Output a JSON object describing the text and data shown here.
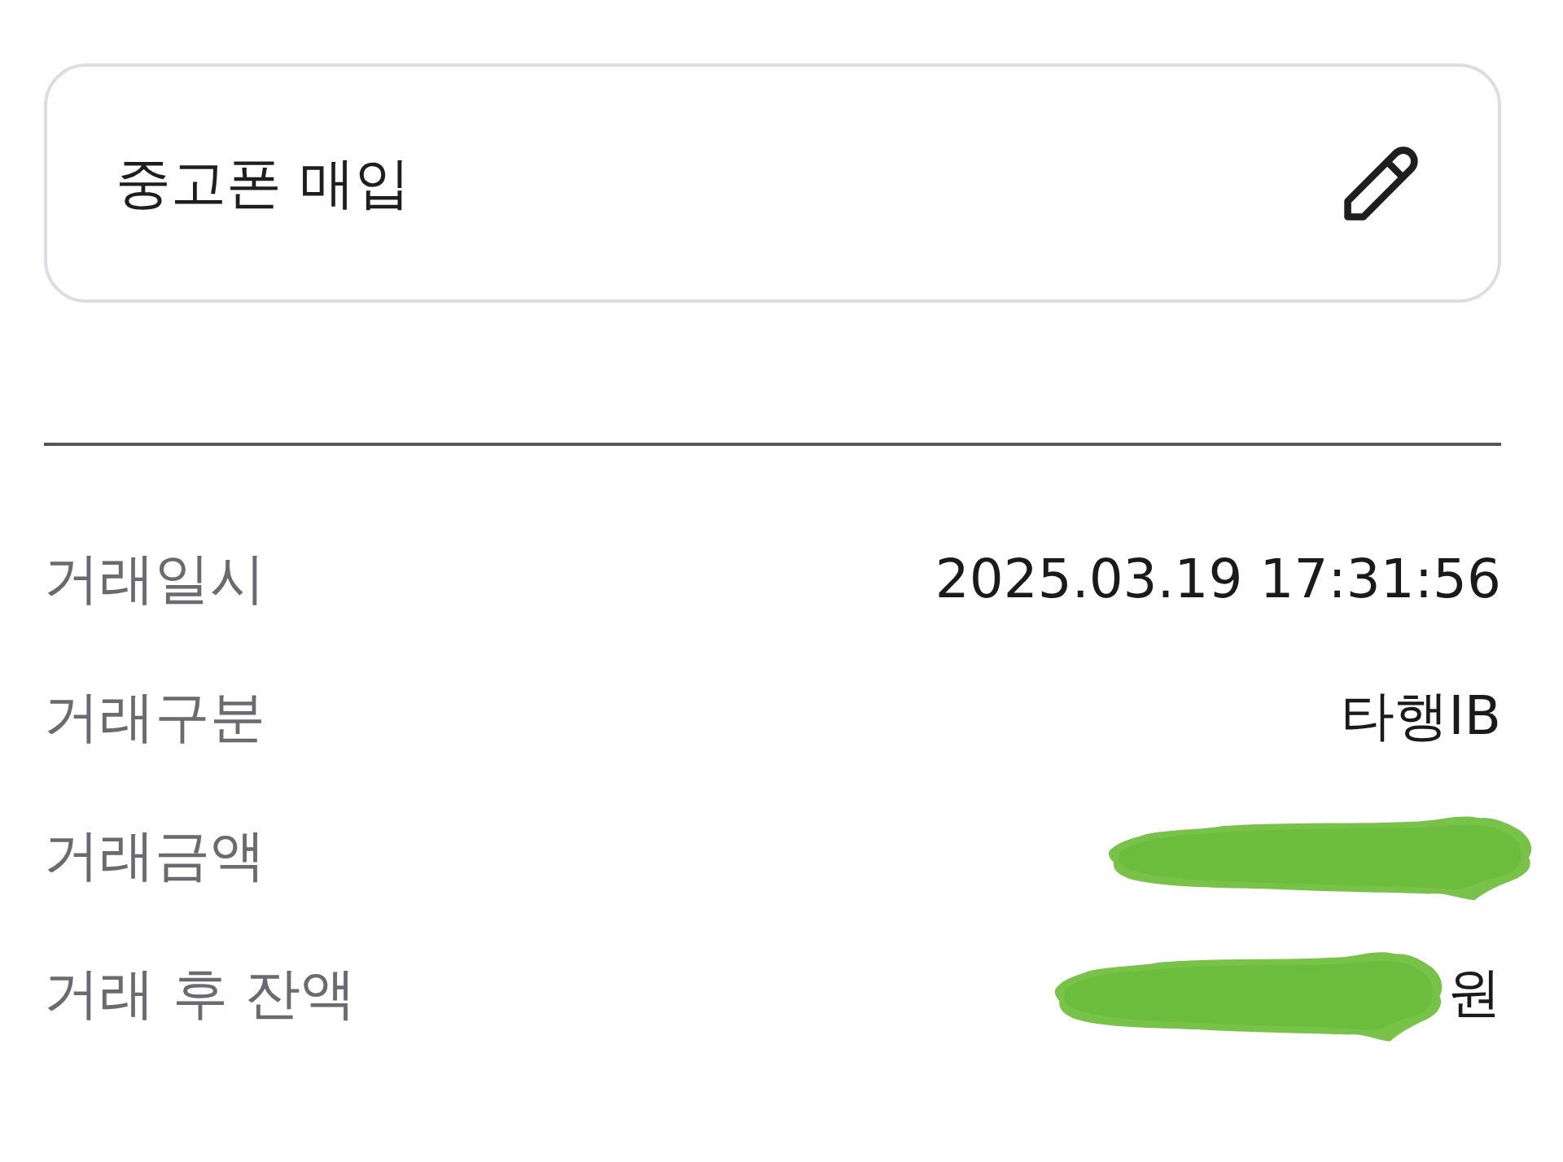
{
  "memo": {
    "text": "중고폰 매입"
  },
  "details": [
    {
      "label": "거래일시",
      "value": "2025.03.19 17:31:56",
      "redacted": false
    },
    {
      "label": "거래구분",
      "value": "타행IB",
      "redacted": false
    },
    {
      "label": "거래금액",
      "redacted": true
    },
    {
      "label": "거래 후 잔액",
      "value": "원",
      "redacted": true
    }
  ]
}
